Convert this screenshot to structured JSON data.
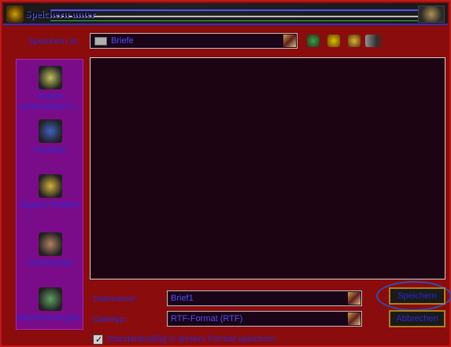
{
  "window": {
    "title": "Speichern unter"
  },
  "save_in": {
    "label": "Speichern in:",
    "value": "Briefe"
  },
  "toolbar": {
    "icons": [
      "back-icon",
      "up-folder-icon",
      "new-folder-icon",
      "view-menu-icon"
    ]
  },
  "places": [
    {
      "label": "Zuletzt verwendete D...",
      "icon": "recent-documents-icon"
    },
    {
      "label": "Desktop",
      "icon": "desktop-icon"
    },
    {
      "label": "Eigene Dateien",
      "icon": "my-documents-icon"
    },
    {
      "label": "Arbeitsplatz",
      "icon": "my-computer-icon"
    },
    {
      "label": "Netzwerkumgeb...",
      "icon": "network-icon"
    }
  ],
  "filename": {
    "label": "Dateiname:",
    "value": "Brief1"
  },
  "filetype": {
    "label": "Dateityp:",
    "value": "RTF-Format (RTF)"
  },
  "buttons": {
    "save": "Speichern",
    "cancel": "Abbrechen"
  },
  "default_format": {
    "label": "Standardmäßig in diesem Format speichern",
    "checked": true
  },
  "colors": {
    "background": "#8a0c0c",
    "places_bar": "#7a0c8a",
    "text": "#2a2ad0"
  }
}
